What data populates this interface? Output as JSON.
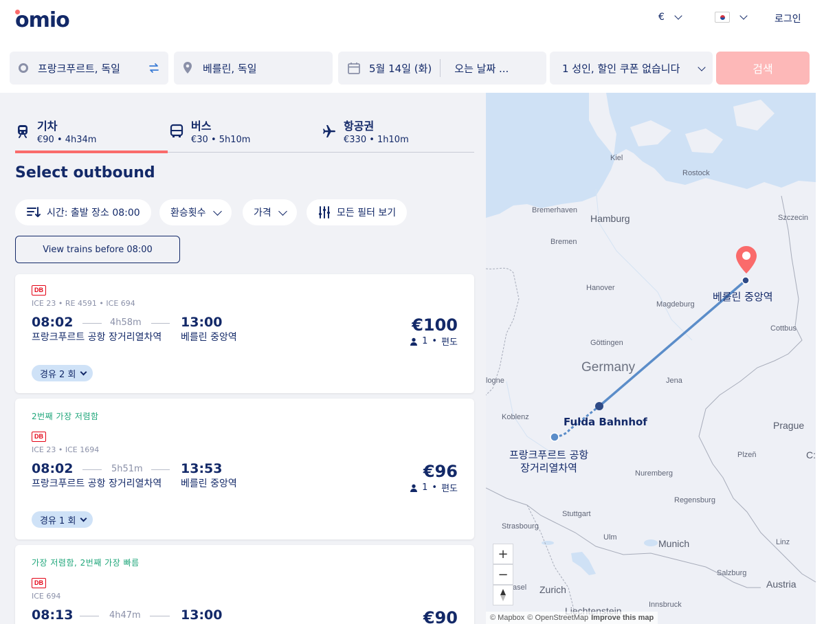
{
  "header": {
    "logo": "omio",
    "currency": "€",
    "login": "로그인",
    "flag_icon": "korea-flag-icon"
  },
  "search": {
    "origin": "프랑크푸르트, 독일",
    "destination": "베를린, 독일",
    "depart_date": "5월 14일 (화)",
    "return_date": "오는 날짜 ...",
    "passengers": "1 성인, 할인 쿠폰 없습니다",
    "search_button": "검색"
  },
  "tabs": [
    {
      "name": "기차",
      "sub": "€90 • 4h34m",
      "icon": "train-icon",
      "active": true
    },
    {
      "name": "버스",
      "sub": "€30 • 5h10m",
      "icon": "bus-icon",
      "active": false
    },
    {
      "name": "항공권",
      "sub": "€330 • 1h10m",
      "icon": "plane-icon",
      "active": false
    }
  ],
  "heading": "Select outbound",
  "filters": {
    "time": "시간: 출발 장소 08:00",
    "transfers": "환승횟수",
    "price": "가격",
    "all_filters": "모든 필터 보기"
  },
  "view_earlier": "View trains before 08:00",
  "results": [
    {
      "tag": "",
      "operator": "DB",
      "trains": "ICE 23 • RE 4591 • ICE 694",
      "depart_time": "08:02",
      "duration": "4h58m",
      "arrive_time": "13:00",
      "depart_station": "프랑크푸르트 공항 장거리열차역",
      "arrive_station": "베를린 중앙역",
      "price": "€100",
      "pax_count": "1",
      "trip_type": "편도",
      "stops": "경유 2 회"
    },
    {
      "tag": "2번째 가장 저렴함",
      "operator": "DB",
      "trains": "ICE 23 • ICE 1694",
      "depart_time": "08:02",
      "duration": "5h51m",
      "arrive_time": "13:53",
      "depart_station": "프랑크푸르트 공항 장거리열차역",
      "arrive_station": "베를린 중앙역",
      "price": "€96",
      "pax_count": "1",
      "trip_type": "편도",
      "stops": "경유 1 회"
    },
    {
      "tag": "가장 저렴함, 2번째 가장 빠름",
      "operator": "DB",
      "trains": "ICE 694",
      "depart_time": "08:13",
      "duration": "4h47m",
      "arrive_time": "13:00",
      "price": "€90"
    }
  ],
  "map": {
    "labels": {
      "kiel": "Kiel",
      "rostock": "Rostock",
      "bremerhaven": "Bremerhaven",
      "hamburg": "Hamburg",
      "szczecin": "Szczecin",
      "bremen": "Bremen",
      "hanover": "Hanover",
      "magdeburg": "Magdeburg",
      "cottbus": "Cottbus",
      "gottingen": "Göttingen",
      "germany": "Germany",
      "jena": "Jena",
      "cologne": "logne",
      "koblenz": "Koblenz",
      "prague": "Prague",
      "plzen": "Plzeň",
      "cz": "C:",
      "nuremberg": "Nuremberg",
      "regensburg": "Regensburg",
      "stuttgart": "Stuttgart",
      "strasbourg": "Strasbourg",
      "ulm": "Ulm",
      "munich": "Munich",
      "linz": "Linz",
      "salzburg": "Salzburg",
      "austria": "Austria",
      "zurich": "Zurich",
      "basel": "asel",
      "liechtenstein": "Liechtenstein",
      "innsbruck": "Innsbruck"
    },
    "route_labels": {
      "destination": "베를린 중앙역",
      "via": "Fulda Bahnhof",
      "origin_line1": "프랑크푸르트 공항",
      "origin_line2": "장거리열차역"
    },
    "zoom_in": "+",
    "zoom_out": "−",
    "attribution": {
      "mapbox": "© Mapbox",
      "osm": "© OpenStreetMap",
      "improve": "Improve this map"
    }
  },
  "colors": {
    "brand_navy": "#132968",
    "accent_red": "#fa6b6b",
    "route_blue": "#5b8dc9",
    "tag_green": "#1fa67a"
  }
}
